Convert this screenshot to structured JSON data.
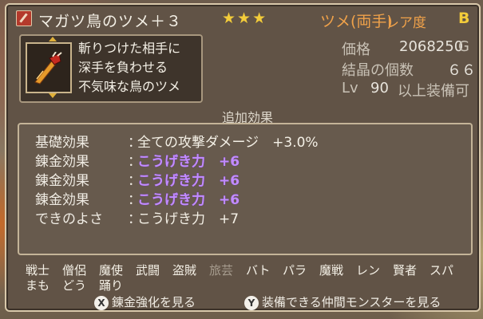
{
  "header": {
    "item_name": "マガツ鳥のツメ＋３",
    "stars": "★★★",
    "weapon_type": "ツメ(両手)",
    "rarity_label": "レア度",
    "rarity_value": "B"
  },
  "description": {
    "lines": [
      "斬りつけた相手に",
      "深手を負わせる",
      "不気味な鳥のツメ"
    ],
    "icon": "bird-claw-icon"
  },
  "stats": {
    "price_label": "価格",
    "price_value": "2068250",
    "price_unit": "G",
    "crystal_label": "結晶の個数",
    "crystal_value": "６６",
    "level_prefix": "Lv",
    "level_value": "90",
    "level_suffix": "以上装備可"
  },
  "effects": {
    "title": "追加効果",
    "rows": [
      {
        "label": "基礎効果",
        "value": "全ての攻撃ダメージ　+3.0%",
        "style": "white"
      },
      {
        "label": "錬金効果",
        "value": "こうげき力　+6",
        "style": "purple"
      },
      {
        "label": "錬金効果",
        "value": "こうげき力　+6",
        "style": "purple"
      },
      {
        "label": "錬金効果",
        "value": "こうげき力　+6",
        "style": "purple"
      },
      {
        "label": "できのよさ",
        "value": "こうげき力　+7",
        "style": "white"
      }
    ]
  },
  "jobs": {
    "row1": [
      {
        "name": "戦士",
        "on": true
      },
      {
        "name": "僧侶",
        "on": true
      },
      {
        "name": "魔使",
        "on": true
      },
      {
        "name": "武闘",
        "on": true
      },
      {
        "name": "盗賊",
        "on": true
      },
      {
        "name": "旅芸",
        "on": false
      },
      {
        "name": "バト",
        "on": true
      },
      {
        "name": "パラ",
        "on": true
      },
      {
        "name": "魔戦",
        "on": true
      },
      {
        "name": "レン",
        "on": true
      },
      {
        "name": "賢者",
        "on": true
      },
      {
        "name": "スパ",
        "on": true
      }
    ],
    "row2": [
      {
        "name": "まも",
        "on": true
      },
      {
        "name": "どう",
        "on": true
      },
      {
        "name": "踊り",
        "on": true
      }
    ]
  },
  "footer": {
    "x_button_glyph": "X",
    "x_button_label": "錬金強化を見る",
    "y_button_glyph": "Y",
    "y_button_label": "装備できる仲間モンスターを見る"
  },
  "colors": {
    "accent_gold": "#f3cc3a",
    "type_orange": "#f0a24a",
    "alchemy_purple": "#c28cff"
  }
}
